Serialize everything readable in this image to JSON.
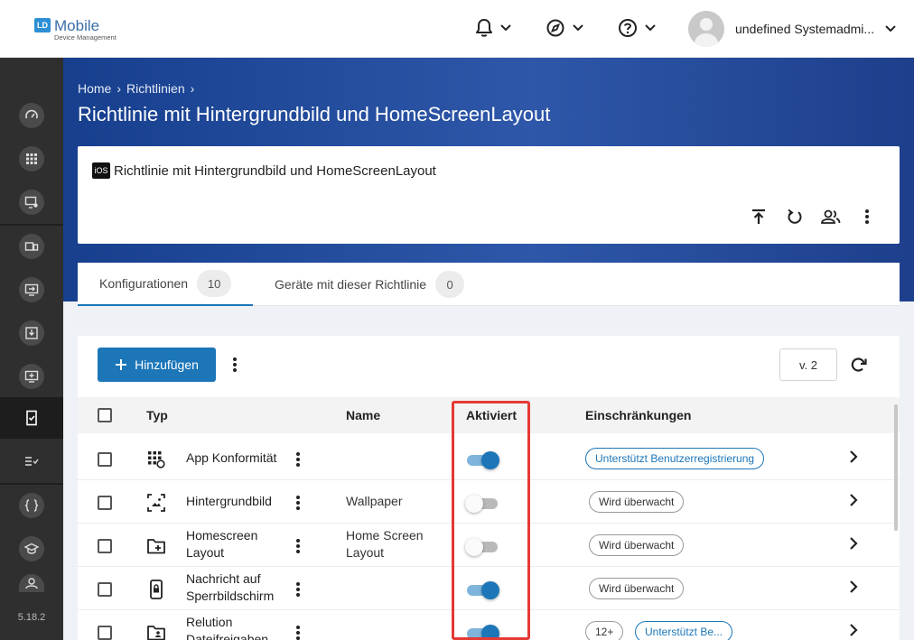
{
  "app": {
    "logo_mark": "LD",
    "logo_title": "Mobile",
    "logo_subtitle": "Device Management",
    "user_name": "undefined Systemadmi...",
    "version": "5.18.2"
  },
  "breadcrumb": [
    "Home",
    "Richtlinien"
  ],
  "page_title": "Richtlinie mit Hintergrundbild und HomeScreenLayout",
  "policy": {
    "platform_badge": "iOS",
    "name": "Richtlinie mit Hintergrundbild und HomeScreenLayout"
  },
  "tabs": [
    {
      "label": "Konfigurationen",
      "count": "10",
      "active": true
    },
    {
      "label": "Geräte mit dieser Richtlinie",
      "count": "0",
      "active": false
    }
  ],
  "toolbar": {
    "add_label": "Hinzufügen",
    "version_value": "v. 2"
  },
  "table": {
    "headers": {
      "type": "Typ",
      "name": "Name",
      "enabled": "Aktiviert",
      "restrictions": "Einschränkungen"
    },
    "rows": [
      {
        "type_lines": [
          "App Konformität"
        ],
        "name_lines": [],
        "enabled": true,
        "icon": "app-grid-icon",
        "chips": [
          {
            "label": "Unterstützt Benutzerregistrierung",
            "style": "blue"
          }
        ]
      },
      {
        "type_lines": [
          "Hintergrundbild"
        ],
        "name_lines": [
          "Wallpaper"
        ],
        "enabled": false,
        "icon": "wallpaper-icon",
        "chips": [
          {
            "label": "Wird überwacht",
            "style": "plain"
          }
        ]
      },
      {
        "type_lines": [
          "Homescreen",
          "Layout"
        ],
        "name_lines": [
          "Home Screen",
          "Layout"
        ],
        "enabled": false,
        "icon": "folder-plus-icon",
        "chips": [
          {
            "label": "Wird überwacht",
            "style": "plain"
          }
        ]
      },
      {
        "type_lines": [
          "Nachricht auf",
          "Sperrbildschirm"
        ],
        "name_lines": [],
        "enabled": true,
        "icon": "phone-lock-icon",
        "chips": [
          {
            "label": "Wird überwacht",
            "style": "plain"
          }
        ]
      },
      {
        "type_lines": [
          "Relution",
          "Dateifreigaben"
        ],
        "name_lines": [],
        "enabled": true,
        "icon": "folder-user-icon",
        "chips": [
          {
            "label": "12+",
            "style": "plain"
          },
          {
            "label": "Unterstützt Be...",
            "style": "blue"
          }
        ]
      }
    ]
  },
  "colors": {
    "accent": "#1c76b8",
    "highlight": "#e53935",
    "sidebar": "#2f2f2f"
  }
}
